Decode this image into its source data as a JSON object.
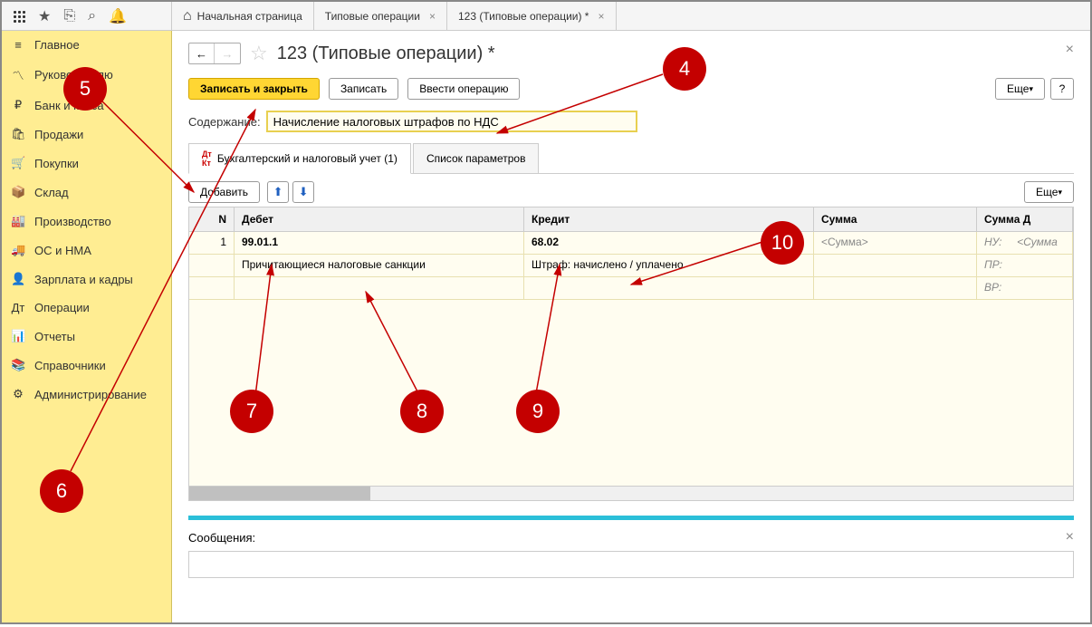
{
  "tabs": {
    "home": "Начальная страница",
    "t1": "Типовые операции",
    "t2": "123 (Типовые операции) *"
  },
  "sidebar": [
    {
      "icon": "≡",
      "label": "Главное"
    },
    {
      "icon": "〽",
      "label": "Руководителю"
    },
    {
      "icon": "₽",
      "label": "Банк и касса"
    },
    {
      "icon": "🛍",
      "label": "Продажи"
    },
    {
      "icon": "🛒",
      "label": "Покупки"
    },
    {
      "icon": "📦",
      "label": "Склад"
    },
    {
      "icon": "🏭",
      "label": "Производство"
    },
    {
      "icon": "🚚",
      "label": "ОС и НМА"
    },
    {
      "icon": "👤",
      "label": "Зарплата и кадры"
    },
    {
      "icon": "Дт",
      "label": "Операции"
    },
    {
      "icon": "📊",
      "label": "Отчеты"
    },
    {
      "icon": "📚",
      "label": "Справочники"
    },
    {
      "icon": "⚙",
      "label": "Администрирование"
    }
  ],
  "page": {
    "title": "123 (Типовые операции) *",
    "save_close": "Записать и закрыть",
    "save": "Записать",
    "enter_op": "Ввести операцию",
    "more": "Еще",
    "help": "?",
    "content_label": "Содержание:",
    "content_value": "Начисление налоговых штрафов по НДС",
    "tab1": "Бухгалтерский и налоговый учет (1)",
    "tab2": "Список параметров",
    "add": "Добавить"
  },
  "grid": {
    "headers": {
      "n": "N",
      "debit": "Дебет",
      "credit": "Кредит",
      "sum": "Сумма",
      "sum2": "Сумма Д"
    },
    "row1": {
      "n": "1",
      "debit_acc": "99.01.1",
      "debit_desc": "Причитающиеся налоговые санкции",
      "credit_acc": "68.02",
      "credit_desc": "Штраф: начислено / уплачено",
      "sum": "<Сумма>",
      "nu": "НУ:",
      "pr": "ПР:",
      "vr": "ВР:",
      "sum2": "<Сумма"
    }
  },
  "messages": {
    "label": "Сообщения:"
  },
  "annotations": {
    "b4": "4",
    "b5": "5",
    "b6": "6",
    "b7": "7",
    "b8": "8",
    "b9": "9",
    "b10": "10"
  }
}
